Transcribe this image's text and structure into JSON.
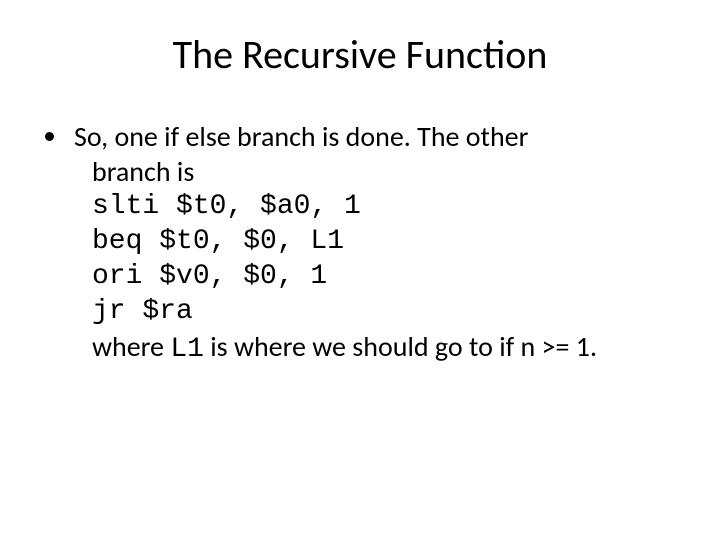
{
  "title": "The Recursive Function",
  "bullet": {
    "lead1": "So, one if else branch is done. The other",
    "lead2": "branch is",
    "code": [
      "slti $t0, $a0, 1",
      "beq $t0, $0, L1",
      "ori $v0, $0, 1",
      "jr $ra"
    ],
    "tail_pre": " where ",
    "tail_code": "L1",
    "tail_post": " is where we should go to if n >= 1."
  }
}
